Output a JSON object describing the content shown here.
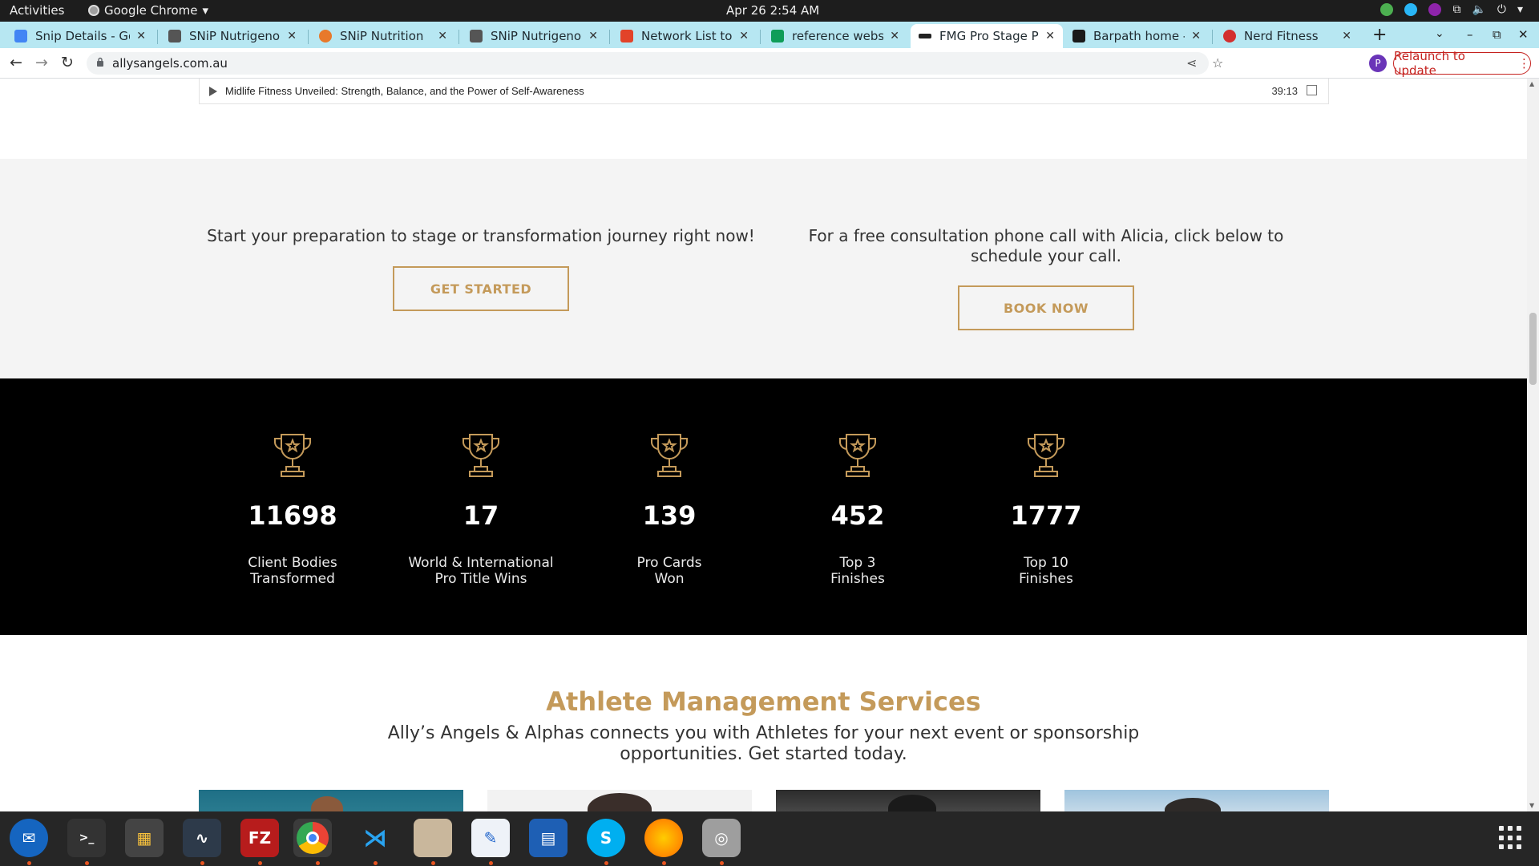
{
  "system_bar": {
    "activities": "Activities",
    "app_name": "Google Chrome",
    "datetime": "Apr 26  2:54 AM"
  },
  "browser": {
    "tabs": [
      {
        "label": "Snip Details - Goo",
        "favicon_color": "#4285f4",
        "active": false
      },
      {
        "label": "SNiP Nutrigenomi",
        "favicon_color": "#555555",
        "active": false
      },
      {
        "label": "SNiP Nutrition",
        "favicon_color": "#e8792b",
        "active": false
      },
      {
        "label": "SNiP Nutrigenomi",
        "favicon_color": "#555555",
        "active": false
      },
      {
        "label": "Network List to Ac",
        "favicon_color": "#e24329",
        "active": false
      },
      {
        "label": "reference website",
        "favicon_color": "#0f9d58",
        "active": false
      },
      {
        "label": "FMG Pro Stage Po",
        "favicon_color": "#222222",
        "active": true
      },
      {
        "label": "Barpath home - Ba",
        "favicon_color": "#1a1a1a",
        "active": false
      },
      {
        "label": "Nerd Fitness",
        "favicon_color": "#d32f2f",
        "active": false
      }
    ],
    "url": "allysangels.com.au",
    "profile_initial": "P",
    "relaunch_label": "Relaunch to update"
  },
  "podcast": {
    "title": "Midlife Fitness Unveiled: Strength, Balance, and the Power of Self-Awareness",
    "duration": "39:13"
  },
  "cta": {
    "left_text": "Start your preparation to stage or transformation journey right now!",
    "left_button": "GET STARTED",
    "right_text": "For a free consultation phone call with Alicia, click below to schedule your call.",
    "right_button": "BOOK NOW"
  },
  "stats": [
    {
      "number": "11698",
      "label": "Client Bodies\nTransformed"
    },
    {
      "number": "17",
      "label": "World & International\nPro Title Wins"
    },
    {
      "number": "139",
      "label": "Pro Cards\nWon"
    },
    {
      "number": "452",
      "label": "Top 3\nFinishes"
    },
    {
      "number": "1777",
      "label": "Top 10\nFinishes"
    }
  ],
  "athlete_management": {
    "title": "Athlete Management Services",
    "subtitle": "Ally’s Angels & Alphas connects you with Athletes for your next event or sponsorship opportunities. Get started today."
  },
  "colors": {
    "accent_gold": "#c49a5a",
    "tab_strip": "#b7e7f2",
    "stats_bg": "#000000"
  },
  "dock": [
    "thunderbird",
    "terminal",
    "calculator",
    "system-monitor",
    "filezilla",
    "chrome",
    "vscode",
    "files",
    "text-editor",
    "libreoffice-writer",
    "skype",
    "firefox-dev",
    "disks"
  ]
}
